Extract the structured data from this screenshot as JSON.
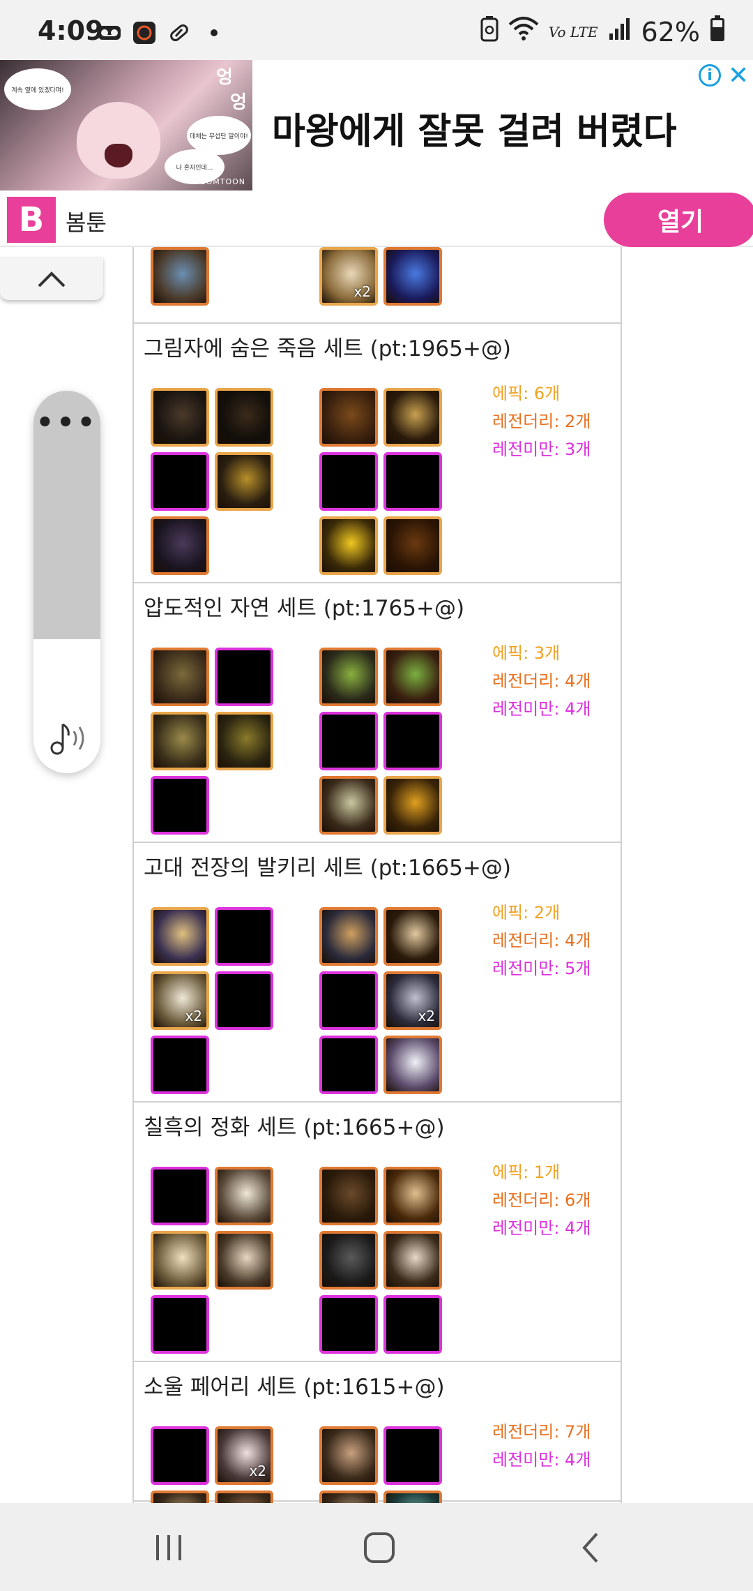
{
  "status_bar": {
    "time": "4:09",
    "battery_percent": "62%",
    "network_label": "Vo LTE",
    "icons": [
      "voicemail-icon",
      "app-icon",
      "pill-icon",
      "dot-icon",
      "battery-saver-icon",
      "wifi-icon",
      "signal-icon",
      "battery-icon"
    ]
  },
  "ad": {
    "headline": "마왕에게 잘못 걸려 버렸다",
    "advertiser": "봄툰",
    "open_button": "열기",
    "logo_letter": "B",
    "image_brand": "BOMTOON",
    "image_bubbles": [
      "계속 옆에 있겠다며!",
      "데체는 무섭단 말이야!",
      "나 혼자인데..."
    ],
    "image_sound": "엉",
    "colors": {
      "brand_pink": "#e8409a",
      "info_blue": "#1aa0e0"
    }
  },
  "sets": [
    {
      "title": "",
      "left_items": [
        {
          "type": "legendary",
          "art": "boots"
        }
      ],
      "right_items": [
        {
          "type": "epic",
          "art": "claw",
          "badge": "x2"
        },
        {
          "type": "legendary",
          "art": "orb-blue"
        }
      ],
      "stats": []
    },
    {
      "title": "그림자에 숨은 죽음 세트 (pt:1965+@)",
      "left_items": [
        {
          "type": "epic",
          "art": "dark-armor"
        },
        {
          "type": "epic",
          "art": "dark-hood"
        },
        {
          "type": "missing"
        },
        {
          "type": "epic",
          "art": "dark-belt"
        },
        {
          "type": "legendary",
          "art": "dark-boots"
        }
      ],
      "right_items": [
        {
          "type": "legendary",
          "art": "dark-cape"
        },
        {
          "type": "epic",
          "art": "dark-sword"
        },
        {
          "type": "missing"
        },
        {
          "type": "missing"
        },
        {
          "type": "epic",
          "art": "lightning"
        },
        {
          "type": "epic",
          "art": "dark-ring"
        }
      ],
      "stats": [
        {
          "label": "에픽: 6개",
          "kind": "epic"
        },
        {
          "label": "레전더리: 2개",
          "kind": "legend"
        },
        {
          "label": "레전미만: 3개",
          "kind": "under"
        }
      ]
    },
    {
      "title": "압도적인 자연 세트 (pt:1765+@)",
      "left_items": [
        {
          "type": "legendary",
          "art": "nature-armor"
        },
        {
          "type": "missing"
        },
        {
          "type": "epic",
          "art": "nature-pants"
        },
        {
          "type": "epic",
          "art": "nature-shoulder"
        },
        {
          "type": "missing"
        }
      ],
      "right_items": [
        {
          "type": "legendary",
          "art": "nature-glove"
        },
        {
          "type": "legendary",
          "art": "nature-amulet"
        },
        {
          "type": "missing"
        },
        {
          "type": "missing"
        },
        {
          "type": "legendary",
          "art": "nature-charm"
        },
        {
          "type": "epic",
          "art": "nature-root"
        }
      ],
      "stats": [
        {
          "label": "에픽: 3개",
          "kind": "epic"
        },
        {
          "label": "레전더리: 4개",
          "kind": "legend"
        },
        {
          "label": "레전미만: 4개",
          "kind": "under"
        }
      ]
    },
    {
      "title": "고대 전장의 발키리 세트 (pt:1665+@)",
      "left_items": [
        {
          "type": "epic",
          "art": "valk-armor"
        },
        {
          "type": "missing"
        },
        {
          "type": "epic",
          "art": "valk-wing",
          "badge": "x2"
        },
        {
          "type": "missing"
        },
        {
          "type": "missing"
        }
      ],
      "right_items": [
        {
          "type": "legendary",
          "art": "valk-bracer"
        },
        {
          "type": "legendary",
          "art": "valk-necklace"
        },
        {
          "type": "missing"
        },
        {
          "type": "legendary",
          "art": "valk-ring",
          "badge": "x2"
        },
        {
          "type": "missing"
        },
        {
          "type": "legendary",
          "art": "valk-orb"
        }
      ],
      "stats": [
        {
          "label": "에픽: 2개",
          "kind": "epic"
        },
        {
          "label": "레전더리: 4개",
          "kind": "legend"
        },
        {
          "label": "레전미만: 5개",
          "kind": "under"
        }
      ]
    },
    {
      "title": "칠흑의 정화 세트 (pt:1665+@)",
      "left_items": [
        {
          "type": "missing"
        },
        {
          "type": "legendary",
          "art": "white-armor"
        },
        {
          "type": "epic",
          "art": "white-skirt"
        },
        {
          "type": "legendary",
          "art": "white-shoulder"
        },
        {
          "type": "missing"
        }
      ],
      "right_items": [
        {
          "type": "legendary",
          "art": "black-ring"
        },
        {
          "type": "legendary",
          "art": "leaf-amulet"
        },
        {
          "type": "legendary",
          "art": "black-orb"
        },
        {
          "type": "legendary",
          "art": "eye-charm"
        },
        {
          "type": "missing"
        },
        {
          "type": "missing"
        }
      ],
      "stats": [
        {
          "label": "에픽: 1개",
          "kind": "epic"
        },
        {
          "label": "레전더리: 6개",
          "kind": "legend"
        },
        {
          "label": "레전미만: 4개",
          "kind": "under"
        }
      ]
    },
    {
      "title": "소울 페어리 세트 (pt:1615+@)",
      "left_items": [
        {
          "type": "missing"
        },
        {
          "type": "legendary",
          "art": "fairy-armor",
          "badge": "x2"
        },
        {
          "type": "legendary",
          "art": "fairy-a"
        },
        {
          "type": "legendary",
          "art": "fairy-b"
        }
      ],
      "right_items": [
        {
          "type": "legendary",
          "art": "fairy-whip"
        },
        {
          "type": "missing"
        },
        {
          "type": "legendary",
          "art": "fairy-c"
        },
        {
          "type": "legendary",
          "art": "fairy-d"
        }
      ],
      "stats": [
        {
          "label": "레전더리: 7개",
          "kind": "legend"
        },
        {
          "label": "레전미만: 4개",
          "kind": "under"
        }
      ]
    }
  ],
  "nav": {
    "icons": [
      "recent-apps-icon",
      "home-icon",
      "back-icon"
    ]
  },
  "floating": {
    "icons": [
      "scroll-up-icon",
      "more-dots-icon",
      "sound-icon"
    ],
    "dots": "•••"
  }
}
